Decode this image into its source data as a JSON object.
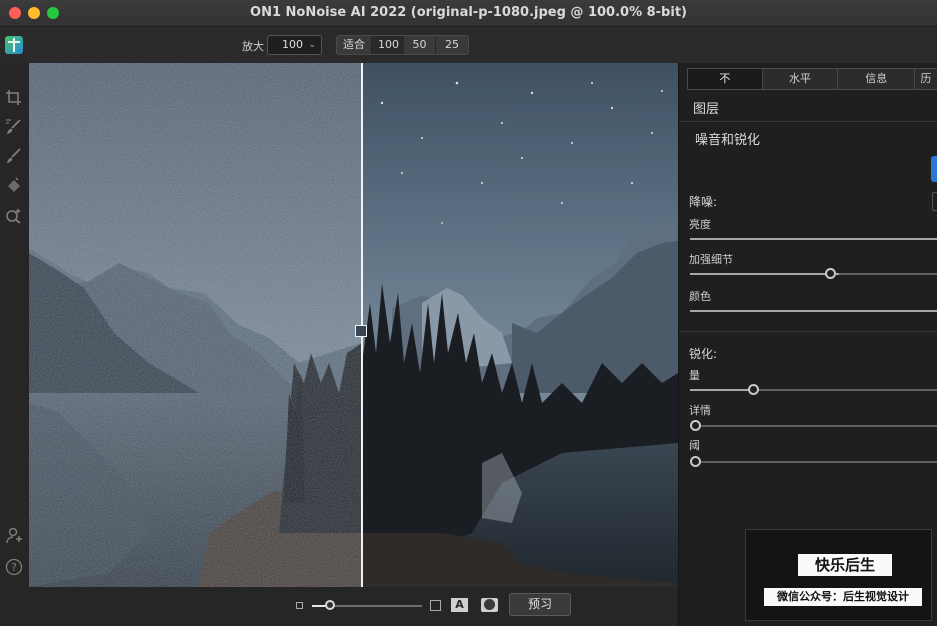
{
  "window": {
    "title": "ON1 NoNoise AI 2022 (original-p-1080.jpeg @ 100.0% 8-bit)"
  },
  "toolbar": {
    "zoom_label": "放大",
    "zoom_value": "100",
    "zoom_presets": [
      "适合",
      "100",
      "50",
      "25"
    ]
  },
  "canvas": {
    "split_position": 0.513
  },
  "bottombar": {
    "zoom_slider_value": 0.16,
    "text_toggle": "A",
    "preview_button": "预习"
  },
  "panel": {
    "tabs": [
      "不",
      "水平",
      "信息",
      "历"
    ],
    "layers_title": "图层",
    "section_title": "噪音和锐化",
    "denoise": {
      "label": "降噪:",
      "sliders": [
        {
          "label": "亮度",
          "value": 1.0
        },
        {
          "label": "加强细节",
          "value": 0.6
        },
        {
          "label": "颜色",
          "value": 1.0
        }
      ]
    },
    "sharpen": {
      "label": "锐化:",
      "sliders": [
        {
          "label": "量",
          "value": 0.26
        },
        {
          "label": "详情",
          "value": 0.0
        },
        {
          "label": "阈",
          "value": 0.0
        }
      ]
    }
  },
  "watermark": {
    "title": "快乐后生",
    "subtitle": "微信公众号：后生视觉设计"
  },
  "colors": {
    "accent_blue": "#2b79d6",
    "traffic_red": "#fe5f57",
    "traffic_yellow": "#febc2e",
    "traffic_green": "#28c840"
  }
}
